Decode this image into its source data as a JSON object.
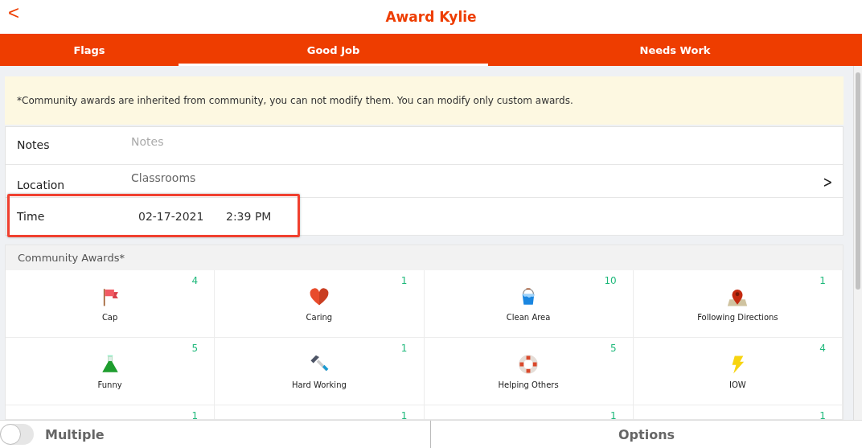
{
  "header": {
    "back": "<",
    "title": "Award Kylie"
  },
  "tabs": [
    {
      "label": "Flags",
      "selected": false
    },
    {
      "label": "Good Job",
      "selected": true
    },
    {
      "label": "Needs Work",
      "selected": false
    }
  ],
  "notice": "*Community awards are inherited from community, you can not modify them. You can modify only custom awards.",
  "form": [
    {
      "kind": "input",
      "label": "Notes",
      "placeholder": "Notes",
      "highlighted": false
    },
    {
      "kind": "select",
      "label": "Location",
      "value": "Classrooms",
      "chevron": ">",
      "highlighted": false
    },
    {
      "kind": "datetime",
      "label": "Time",
      "date": "02-17-2021",
      "time": "2:39 PM",
      "highlighted": true
    }
  ],
  "awards": {
    "title": "Community Awards*",
    "items": [
      {
        "name": "Cap",
        "count": "4"
      },
      {
        "name": "Caring",
        "count": "1"
      },
      {
        "name": "Clean Area",
        "count": "10"
      },
      {
        "name": "Following Directions",
        "count": "1"
      },
      {
        "name": "Funny",
        "count": "5"
      },
      {
        "name": "Hard Working",
        "count": "1"
      },
      {
        "name": "Helping Others",
        "count": "5"
      },
      {
        "name": "IOW",
        "count": "4"
      },
      {
        "count": "1"
      },
      {
        "count": "1"
      },
      {
        "count": "1"
      },
      {
        "count": "1"
      }
    ]
  },
  "footer": {
    "multiple": {
      "label": "Multiple",
      "on": false
    },
    "options": "Options"
  }
}
